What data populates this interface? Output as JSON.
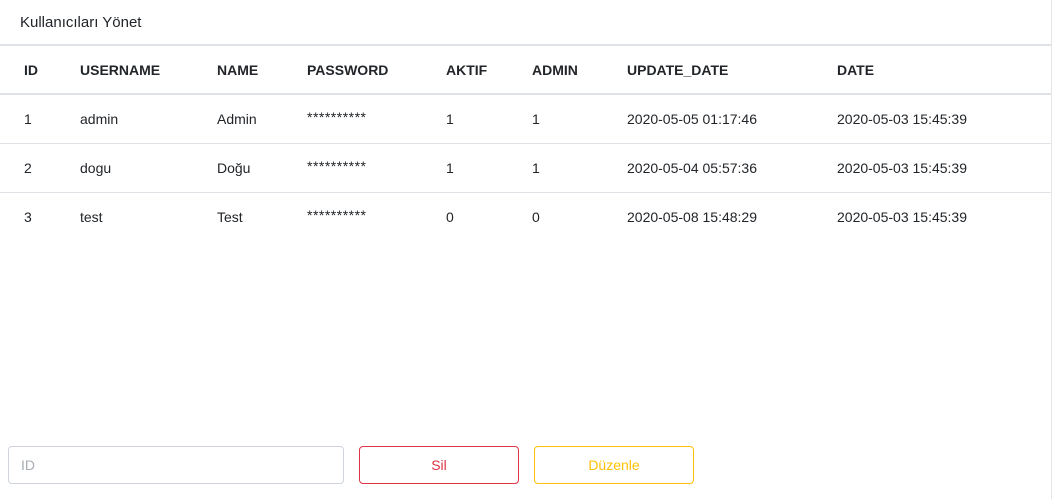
{
  "header": {
    "title": "Kullanıcıları Yönet"
  },
  "table": {
    "columns": [
      "ID",
      "USERNAME",
      "NAME",
      "PASSWORD",
      "AKTIF",
      "ADMIN",
      "UPDATE_DATE",
      "DATE"
    ],
    "rows": [
      [
        "1",
        "admin",
        "Admin",
        "**********",
        "1",
        "1",
        "2020-05-05 01:17:46",
        "2020-05-03 15:45:39"
      ],
      [
        "2",
        "dogu",
        "Doğu",
        "**********",
        "1",
        "1",
        "2020-05-04 05:57:36",
        "2020-05-03 15:45:39"
      ],
      [
        "3",
        "test",
        "Test",
        "**********",
        "0",
        "0",
        "2020-05-08 15:48:29",
        "2020-05-03 15:45:39"
      ]
    ]
  },
  "form": {
    "id_placeholder": "ID",
    "id_value": "",
    "delete_label": "Sil",
    "edit_label": "Düzenle"
  },
  "colors": {
    "danger": "#dc3545",
    "warning": "#ffc107",
    "border": "#dee2e6"
  }
}
